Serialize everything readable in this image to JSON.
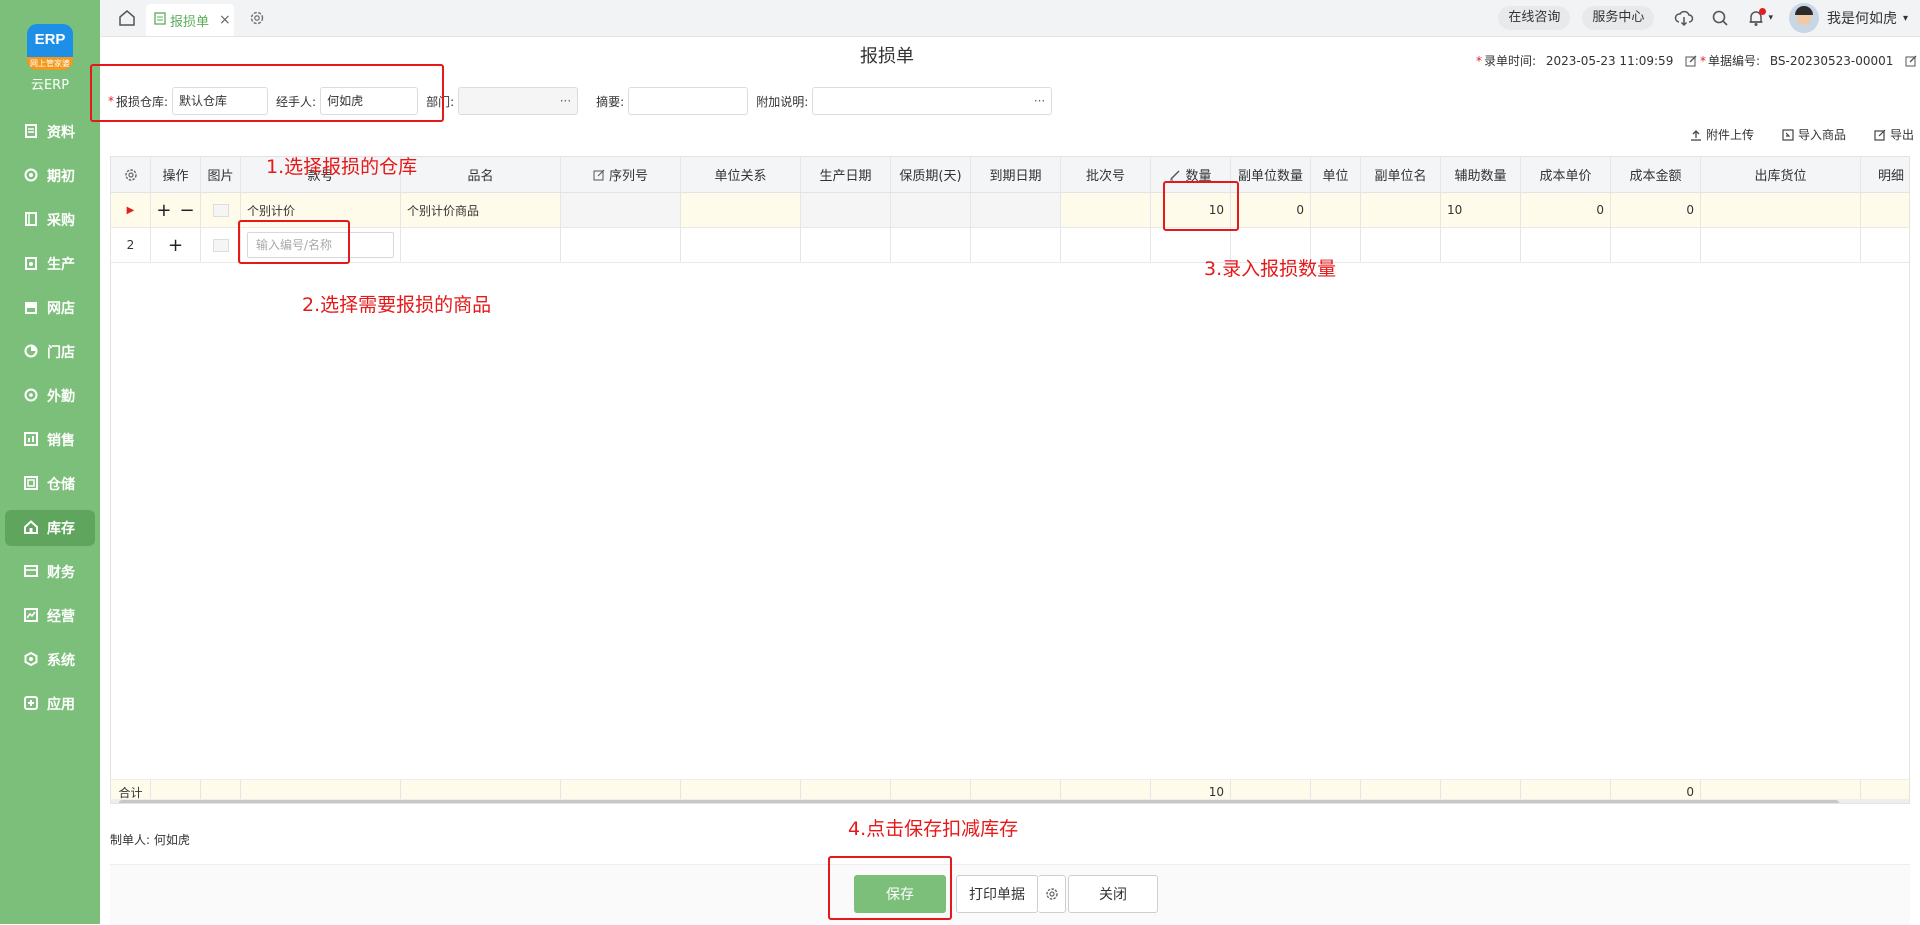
{
  "sidebar": {
    "logo_text": "ERP",
    "logo_tag": "网上管家婆",
    "app_name": "云ERP",
    "items": [
      {
        "label": "资料",
        "icon": "document-icon"
      },
      {
        "label": "期初",
        "icon": "target-icon"
      },
      {
        "label": "采购",
        "icon": "book-icon"
      },
      {
        "label": "生产",
        "icon": "factory-icon"
      },
      {
        "label": "网店",
        "icon": "store-icon"
      },
      {
        "label": "门店",
        "icon": "pie-icon"
      },
      {
        "label": "外勤",
        "icon": "compass-icon"
      },
      {
        "label": "销售",
        "icon": "chart-icon"
      },
      {
        "label": "仓储",
        "icon": "warehouse-icon"
      },
      {
        "label": "库存",
        "icon": "home-icon"
      },
      {
        "label": "财务",
        "icon": "wallet-icon"
      },
      {
        "label": "经营",
        "icon": "trend-icon"
      },
      {
        "label": "系统",
        "icon": "settings-icon"
      },
      {
        "label": "应用",
        "icon": "plus-square-icon"
      }
    ],
    "active_label": "库存"
  },
  "topbar": {
    "tab_label": "报损单",
    "tab_close": "×",
    "online_consult": "在线咨询",
    "service_center": "服务中心",
    "user_name": "我是何如虎",
    "caret": "▾"
  },
  "header": {
    "title": "报损单",
    "entry_time_label": "录单时间:",
    "entry_time": "2023-05-23 11:09:59",
    "doc_no_label": "单据编号:",
    "doc_no": "BS-20230523-00001"
  },
  "form": {
    "warehouse_label": "报损仓库:",
    "warehouse_value": "默认仓库",
    "handler_label": "经手人:",
    "handler_value": "何如虎",
    "dept_label": "部门:",
    "dept_value": "",
    "summary_label": "摘要:",
    "summary_value": "",
    "note_label": "附加说明:",
    "note_value": "",
    "dots": "···"
  },
  "actions": {
    "upload": "附件上传",
    "import": "导入商品",
    "export": "导出"
  },
  "table": {
    "headers": {
      "op": "操作",
      "pic": "图片",
      "code": "款号",
      "name": "品名",
      "serial": "序列号",
      "unit_rel": "单位关系",
      "prod_date": "生产日期",
      "shelf": "保质期(天)",
      "expiry": "到期日期",
      "batch": "批次号",
      "qty": "数量",
      "sub_qty": "副单位数量",
      "unit": "单位",
      "sub_unit": "副单位名",
      "aux_qty": "辅助数量",
      "cost_price": "成本单价",
      "cost_amount": "成本金额",
      "location": "出库货位",
      "detail": "明细"
    },
    "row1": {
      "marker": "▶",
      "plus": "+",
      "minus": "−",
      "code": "个别计价",
      "name": "个别计价商品",
      "qty": "10",
      "sub_qty": "0",
      "aux_qty": "10",
      "cost_price": "0",
      "cost_amount": "0"
    },
    "row2": {
      "index": "2",
      "plus": "+",
      "input_placeholder": "输入编号/名称"
    },
    "footer": {
      "label": "合计",
      "qty_total": "10",
      "amount_total": "0"
    }
  },
  "creator": {
    "label": "制单人:",
    "value": "何如虎"
  },
  "buttons": {
    "save": "保存",
    "print": "打印单据",
    "close": "关闭"
  },
  "annotations": {
    "step1": "1.选择报损的仓库",
    "step2": "2.选择需要报损的商品",
    "step3": "3.录入报损数量",
    "step4": "4.点击保存扣减库存"
  },
  "colors": {
    "brand_green": "#7cbf7a",
    "annotation_red": "#e5191a"
  }
}
